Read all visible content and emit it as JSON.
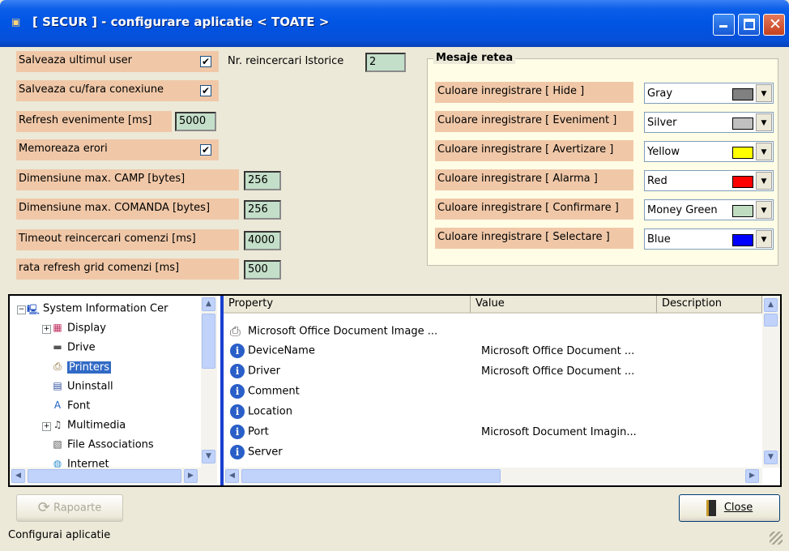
{
  "window": {
    "icon": "app-icon",
    "title": "[ SECUR ] - configurare aplicatie < TOATE >"
  },
  "settings": {
    "save_last_user": {
      "label": "Salveaza ultimul user",
      "checked": true
    },
    "save_with_connection": {
      "label": "Salveaza cu/fara conexiune",
      "checked": true
    },
    "refresh_events": {
      "label": "Refresh evenimente [ms]",
      "value": "5000"
    },
    "remember_errors": {
      "label": "Memoreaza erori",
      "checked": true
    },
    "max_camp": {
      "label": "Dimensiune max. CAMP [bytes]",
      "value": "256"
    },
    "max_comanda": {
      "label": "Dimensiune max. COMANDA [bytes]",
      "value": "256"
    },
    "timeout": {
      "label": "Timeout reincercari comenzi [ms]",
      "value": "4000"
    },
    "grid_refresh": {
      "label": "rata refresh grid comenzi [ms]",
      "value": "500"
    },
    "history_retries": {
      "label": "Nr. reincercari Istorice",
      "value": "2"
    }
  },
  "network_messages": {
    "title": "Mesaje retea",
    "items": [
      {
        "label": "Culoare inregistrare [ Hide ]",
        "value": "Gray",
        "color": "#808080"
      },
      {
        "label": "Culoare inregistrare [ Eveniment ]",
        "value": "Silver",
        "color": "#c0c0c0"
      },
      {
        "label": "Culoare inregistrare [ Avertizare ]",
        "value": "Yellow",
        "color": "#ffff00"
      },
      {
        "label": "Culoare inregistrare [ Alarma ]",
        "value": "Red",
        "color": "#ff0000"
      },
      {
        "label": "Culoare inregistrare [ Confirmare ]",
        "value": "Money Green",
        "color": "#c0dcc0"
      },
      {
        "label": "Culoare inregistrare [ Selectare ]",
        "value": "Blue",
        "color": "#0000ff"
      }
    ]
  },
  "tree": {
    "items": [
      {
        "label": "System Information Cer",
        "icon": "computer-icon"
      },
      {
        "label": "Display",
        "icon": "display-icon"
      },
      {
        "label": "Drive",
        "icon": "drive-icon"
      },
      {
        "label": "Printers",
        "icon": "printer-icon",
        "selected": true
      },
      {
        "label": "Uninstall",
        "icon": "uninstall-icon"
      },
      {
        "label": "Font",
        "icon": "font-icon"
      },
      {
        "label": "Multimedia",
        "icon": "multimedia-icon"
      },
      {
        "label": "File Associations",
        "icon": "file-associations-icon"
      },
      {
        "label": "Internet",
        "icon": "globe-icon"
      }
    ]
  },
  "list": {
    "columns": [
      "Property",
      "Value",
      "Description"
    ],
    "rows": [
      {
        "property": "Microsoft Office Document Image ...",
        "value": "",
        "icon": "printer-icon"
      },
      {
        "property": "DeviceName",
        "value": "Microsoft Office Document ...",
        "icon": "info-icon"
      },
      {
        "property": "Driver",
        "value": "Microsoft Office Document ...",
        "icon": "info-icon"
      },
      {
        "property": "Comment",
        "value": "",
        "icon": "info-icon"
      },
      {
        "property": "Location",
        "value": "",
        "icon": "info-icon"
      },
      {
        "property": "Port",
        "value": "Microsoft Document Imagin...",
        "icon": "info-icon"
      },
      {
        "property": "Server",
        "value": "",
        "icon": "info-icon"
      }
    ]
  },
  "buttons": {
    "reports": "Rapoarte",
    "close": "Close"
  },
  "status": "Configurai aplicatie"
}
